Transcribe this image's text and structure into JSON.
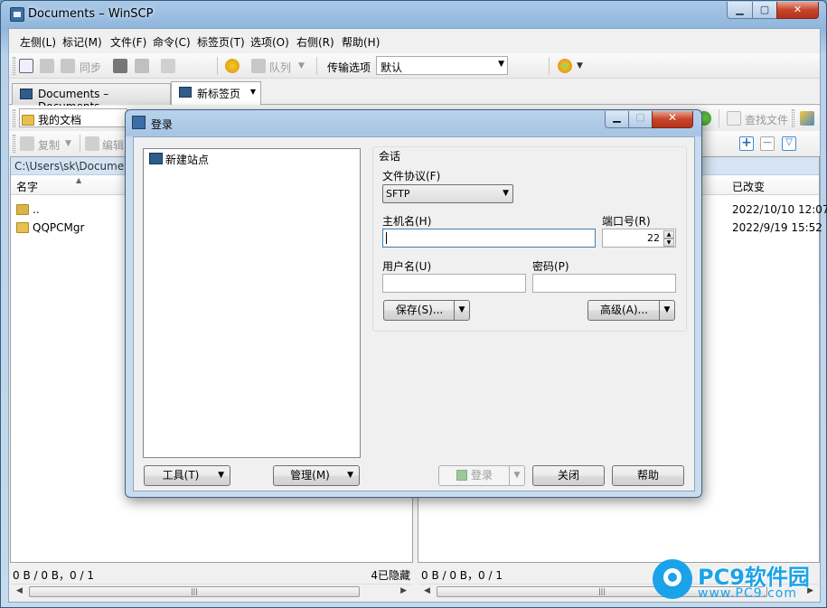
{
  "window": {
    "title": "Documents – WinSCP",
    "min": "▁",
    "max": "▢",
    "close": "✕"
  },
  "menu": [
    "左侧(L)",
    "标记(M)",
    "文件(F)",
    "命令(C)",
    "标签页(T)",
    "选项(O)",
    "右侧(R)",
    "帮助(H)"
  ],
  "toolbar1": {
    "sync_label": "同步",
    "queue_label": "队列",
    "transfer_label": "传输选项",
    "transfer_value": "默认"
  },
  "tabs": [
    {
      "label": "Documents – Documents"
    },
    {
      "label": "新标签页"
    }
  ],
  "left_toolbar": {
    "location": "我的文档",
    "copy_label": "复制",
    "edit_label": "编辑"
  },
  "right_toolbar": {
    "find_label": "查找文件"
  },
  "left_panel": {
    "path": "C:\\Users\\sk\\Documents",
    "col_name": "名字",
    "rows": [
      {
        "name": ".."
      },
      {
        "name": "QQPCMgr"
      }
    ],
    "status_left": "0 B / 0 B，0 / 1",
    "status_right": "4已隐藏"
  },
  "right_panel": {
    "col_changed": "已改变",
    "rows": [
      {
        "changed": "2022/10/10 12:07"
      },
      {
        "changed": "2022/9/19 15:52"
      }
    ],
    "status_left": "0 B / 0 B，0 / 1"
  },
  "dialog": {
    "title": "登录",
    "site_item": "新建站点",
    "session_label": "会话",
    "protocol_label": "文件协议(F)",
    "protocol_value": "SFTP",
    "host_label": "主机名(H)",
    "host_value": "",
    "port_label": "端口号(R)",
    "port_value": "22",
    "user_label": "用户名(U)",
    "user_value": "",
    "password_label": "密码(P)",
    "password_value": "",
    "save_button": "保存(S)...",
    "advanced_button": "高级(A)...",
    "tools_button": "工具(T)",
    "manage_button": "管理(M)",
    "login_button": "登录",
    "close_button": "关闭",
    "help_button": "帮助"
  },
  "watermark": {
    "brand": "PC9软件园",
    "url": "www.PC9.com"
  },
  "colors": {
    "accent": "#3a6ea5",
    "watermark": "#1aa3e8",
    "titlebar": "#a9c9e8",
    "close": "#c6452a"
  }
}
